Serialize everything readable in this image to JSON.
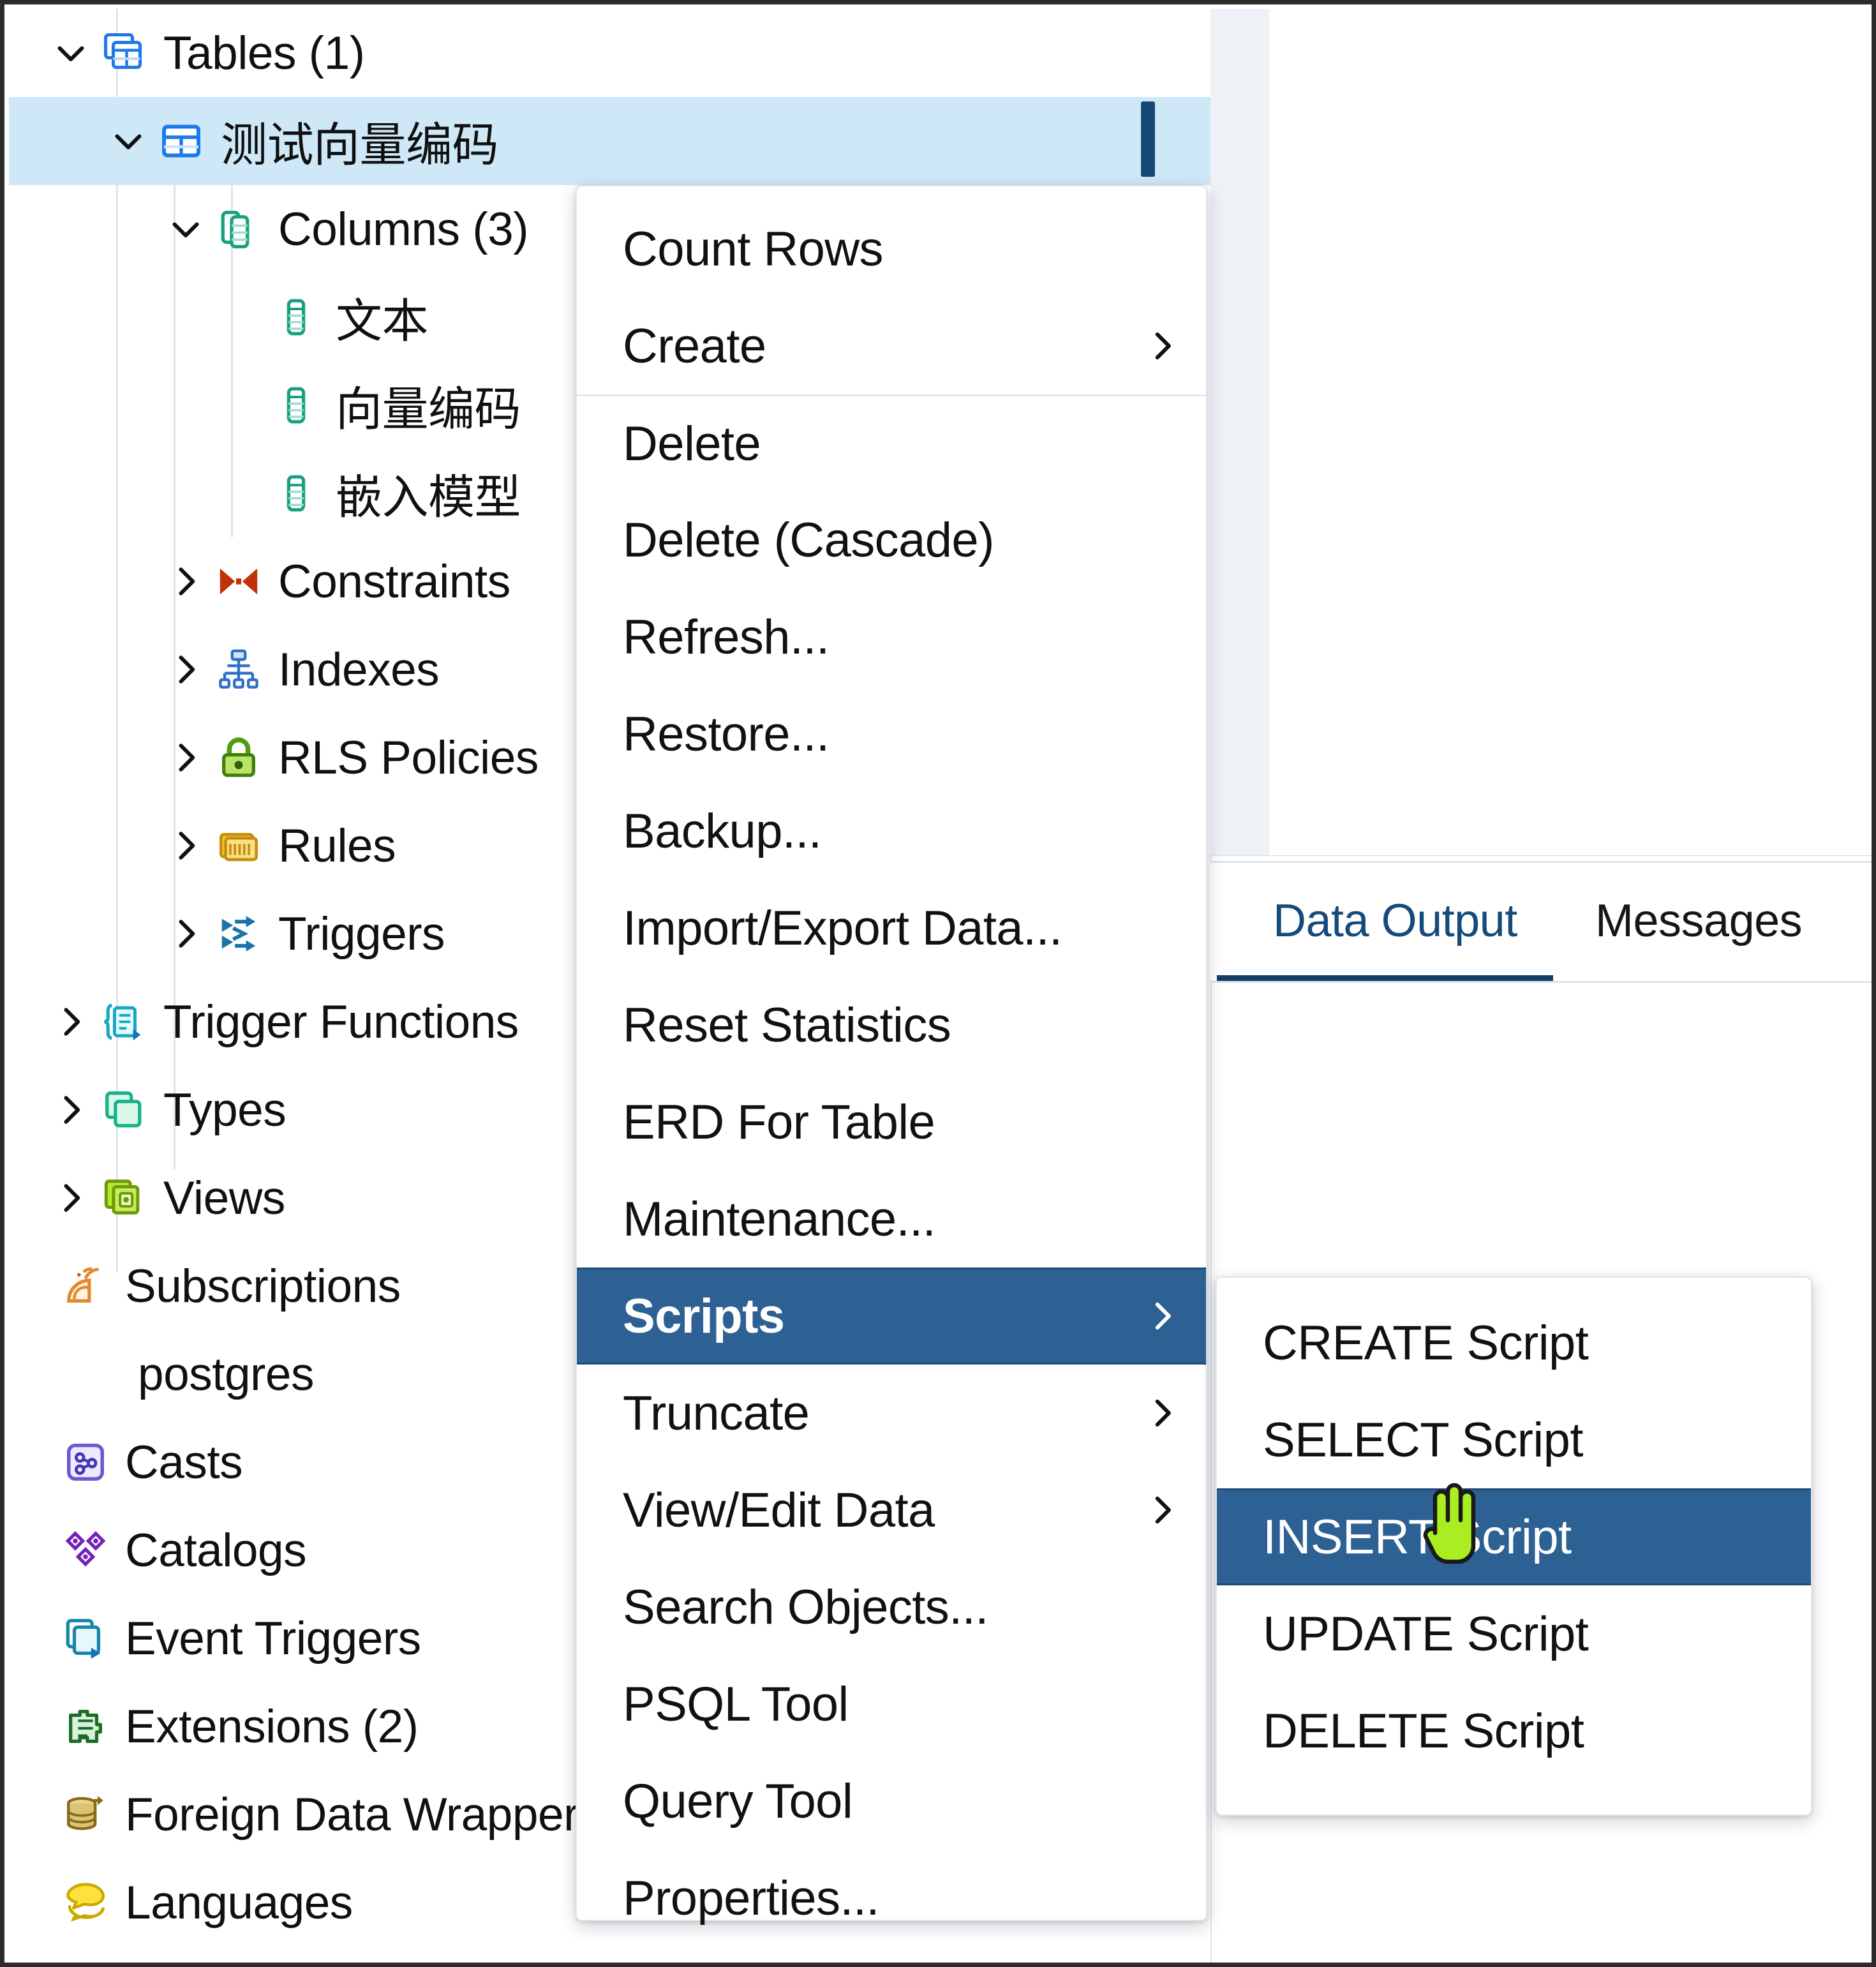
{
  "tree": {
    "items": [
      {
        "label": "Tables (1)",
        "icon": "tables-icon",
        "indent": 60,
        "twist": "down",
        "selected": false
      },
      {
        "label": "测试向量编码",
        "icon": "table-icon",
        "indent": 150,
        "twist": "down",
        "selected": true,
        "cjk": true
      },
      {
        "label": "Columns (3)",
        "icon": "columns-icon",
        "indent": 240,
        "twist": "down",
        "selected": false
      },
      {
        "label": "文本",
        "icon": "column-icon",
        "indent": 330,
        "twist": "none",
        "selected": false,
        "cjk": true
      },
      {
        "label": "向量编码",
        "icon": "column-icon",
        "indent": 330,
        "twist": "none",
        "selected": false,
        "cjk": true
      },
      {
        "label": "嵌入模型",
        "icon": "column-icon",
        "indent": 330,
        "twist": "none",
        "selected": false,
        "cjk": true
      },
      {
        "label": "Constraints",
        "icon": "constraints-icon",
        "indent": 240,
        "twist": "right",
        "selected": false
      },
      {
        "label": "Indexes",
        "icon": "indexes-icon",
        "indent": 240,
        "twist": "right",
        "selected": false
      },
      {
        "label": "RLS Policies",
        "icon": "rls-policies-icon",
        "indent": 240,
        "twist": "right",
        "selected": false
      },
      {
        "label": "Rules",
        "icon": "rules-icon",
        "indent": 240,
        "twist": "right",
        "selected": false
      },
      {
        "label": "Triggers",
        "icon": "triggers-icon",
        "indent": 240,
        "twist": "right",
        "selected": false
      },
      {
        "label": "Trigger Functions",
        "icon": "trigger-functions-icon",
        "indent": 60,
        "twist": "right",
        "selected": false
      },
      {
        "label": "Types",
        "icon": "types-icon",
        "indent": 60,
        "twist": "right",
        "selected": false
      },
      {
        "label": "Views",
        "icon": "views-icon",
        "indent": 60,
        "twist": "right",
        "selected": false
      },
      {
        "label": "Subscriptions",
        "icon": "subscriptions-icon",
        "indent": 0,
        "twist": "none",
        "selected": false
      },
      {
        "label": "postgres",
        "icon": "none",
        "indent": 20,
        "twist": "none",
        "selected": false
      },
      {
        "label": "Casts",
        "icon": "casts-icon",
        "indent": 0,
        "twist": "none",
        "selected": false
      },
      {
        "label": "Catalogs",
        "icon": "catalogs-icon",
        "indent": 0,
        "twist": "none",
        "selected": false
      },
      {
        "label": "Event Triggers",
        "icon": "event-triggers-icon",
        "indent": 0,
        "twist": "none",
        "selected": false
      },
      {
        "label": "Extensions (2)",
        "icon": "extensions-icon",
        "indent": 0,
        "twist": "none",
        "selected": false
      },
      {
        "label": "Foreign Data Wrappers",
        "icon": "foreign-data-wrappers-icon",
        "indent": 0,
        "twist": "none",
        "selected": false
      },
      {
        "label": "Languages",
        "icon": "languages-icon",
        "indent": 0,
        "twist": "none",
        "selected": false
      }
    ]
  },
  "output_panel": {
    "tabs": [
      {
        "label": "Data Output",
        "active": true
      },
      {
        "label": "Messages",
        "active": false
      }
    ]
  },
  "context_menu": {
    "items": [
      {
        "label": "Count Rows",
        "submenu": false,
        "separator_above": false,
        "highlighted": false
      },
      {
        "label": "Create",
        "submenu": true,
        "separator_above": false,
        "highlighted": false
      },
      {
        "label": "Delete",
        "submenu": false,
        "separator_above": true,
        "highlighted": false
      },
      {
        "label": "Delete (Cascade)",
        "submenu": false,
        "separator_above": false,
        "highlighted": false
      },
      {
        "label": "Refresh...",
        "submenu": false,
        "separator_above": false,
        "highlighted": false
      },
      {
        "label": "Restore...",
        "submenu": false,
        "separator_above": false,
        "highlighted": false
      },
      {
        "label": "Backup...",
        "submenu": false,
        "separator_above": false,
        "highlighted": false
      },
      {
        "label": "Import/Export Data...",
        "submenu": false,
        "separator_above": false,
        "highlighted": false
      },
      {
        "label": "Reset Statistics",
        "submenu": false,
        "separator_above": false,
        "highlighted": false
      },
      {
        "label": "ERD For Table",
        "submenu": false,
        "separator_above": false,
        "highlighted": false
      },
      {
        "label": "Maintenance...",
        "submenu": false,
        "separator_above": false,
        "highlighted": false
      },
      {
        "label": "Scripts",
        "submenu": true,
        "separator_above": false,
        "highlighted": true
      },
      {
        "label": "Truncate",
        "submenu": true,
        "separator_above": false,
        "highlighted": false
      },
      {
        "label": "View/Edit Data",
        "submenu": true,
        "separator_above": false,
        "highlighted": false
      },
      {
        "label": "Search Objects...",
        "submenu": false,
        "separator_above": false,
        "highlighted": false
      },
      {
        "label": "PSQL Tool",
        "submenu": false,
        "separator_above": false,
        "highlighted": false
      },
      {
        "label": "Query Tool",
        "submenu": false,
        "separator_above": false,
        "highlighted": false
      },
      {
        "label": "Properties...",
        "submenu": false,
        "separator_above": false,
        "highlighted": false
      }
    ]
  },
  "scripts_submenu": {
    "items": [
      {
        "label": "CREATE Script",
        "highlighted": false
      },
      {
        "label": "SELECT Script",
        "highlighted": false
      },
      {
        "label": "INSERT Script",
        "highlighted": true
      },
      {
        "label": "UPDATE Script",
        "highlighted": false
      },
      {
        "label": "DELETE Script",
        "highlighted": false
      }
    ]
  },
  "colors": {
    "selection_row": "#cfe8f8",
    "menu_highlight": "#2d6193",
    "tab_active": "#144a7c",
    "tab_underline": "#123e66",
    "cursor": "#aaee22"
  }
}
